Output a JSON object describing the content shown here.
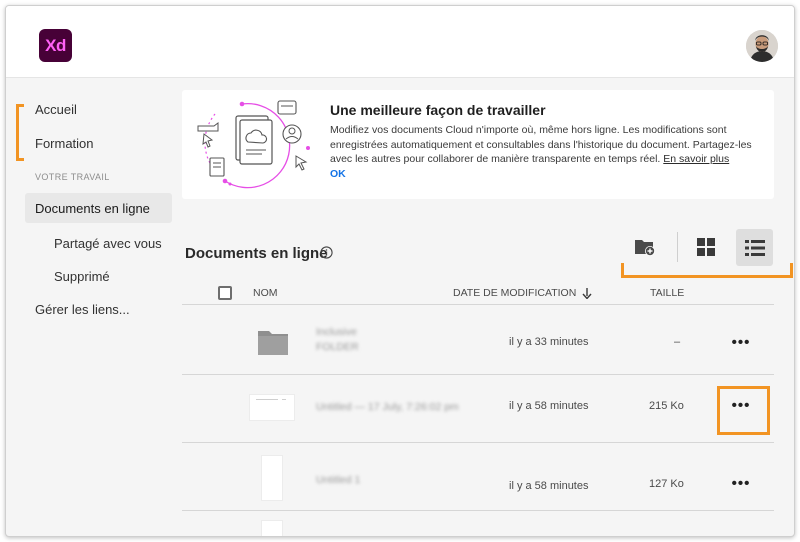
{
  "app": {
    "logo_text": "Xd",
    "accent": "#470137",
    "logo_fg": "#ff61f6"
  },
  "sidebar": {
    "items": [
      {
        "label": "Accueil"
      },
      {
        "label": "Formation"
      }
    ],
    "section_label": "VOTRE TRAVAIL",
    "work_items": [
      {
        "label": "Documents en ligne",
        "active": true
      },
      {
        "label": "Partagé avec vous"
      },
      {
        "label": "Supprimé"
      }
    ],
    "manage_links": "Gérer les liens..."
  },
  "banner": {
    "title": "Une meilleure façon de travailler",
    "body": "Modifiez vos documents Cloud n'importe où, même hors ligne. Les modifications sont enregistrées automatiquement et consultables dans l'historique du document. Partagez-les avec les autres pour collaborer de manière transparente en temps réel.",
    "link": "En savoir plus",
    "ok": "OK"
  },
  "main": {
    "title": "Documents en ligne",
    "toolbar": {
      "new_folder_icon": "folder-add-icon",
      "grid_icon": "grid-view-icon",
      "list_icon": "list-view-icon"
    }
  },
  "table": {
    "columns": {
      "name": "NOM",
      "modified": "DATE DE MODIFICATION",
      "size": "TAILLE"
    },
    "rows": [
      {
        "type": "folder",
        "name": "Inclusive FOLDER",
        "modified": "il y a 33 minutes",
        "size": "–"
      },
      {
        "type": "doc-wide",
        "name": "Untitled — 17 July, 7:26:02 pm",
        "modified": "il y a 58 minutes",
        "size": "215 Ko"
      },
      {
        "type": "doc-tall",
        "name": "Untitled 1",
        "modified": "il y a 58 minutes",
        "size": "127 Ko"
      }
    ],
    "more_label": "•••"
  },
  "highlight_color": "#f29423"
}
